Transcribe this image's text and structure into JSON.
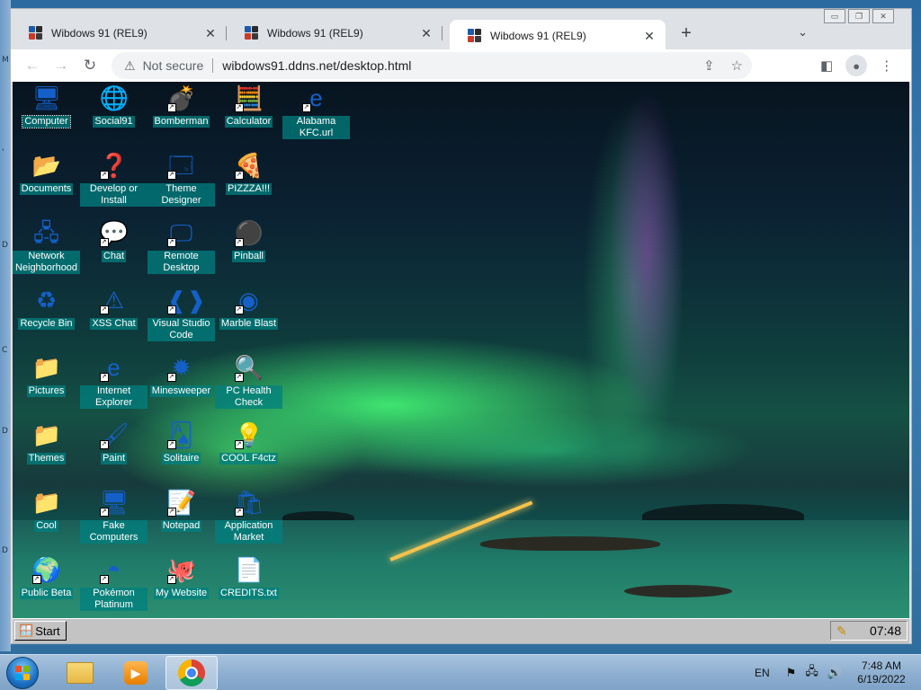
{
  "browser": {
    "tabs": [
      {
        "title": "Wibdows 91 (REL9)",
        "active": false
      },
      {
        "title": "Wibdows 91 (REL9)",
        "active": false
      },
      {
        "title": "Wibdows 91 (REL9)",
        "active": true
      }
    ],
    "new_tab": "+",
    "tab_list": "⌄",
    "security": "Not secure",
    "url": "wibdows91.ddns.net/desktop.html"
  },
  "desktop_icons": [
    {
      "label": "Computer",
      "icon": "computer-icon",
      "shortcut": false,
      "selected": true
    },
    {
      "label": "Social91",
      "icon": "globe-icon",
      "shortcut": false
    },
    {
      "label": "Bomberman",
      "icon": "bomberman-icon",
      "shortcut": true
    },
    {
      "label": "Calculator",
      "icon": "calculator-icon",
      "shortcut": true
    },
    {
      "label": "Alabama KFC.url",
      "icon": "ie-url-icon",
      "shortcut": true
    },
    {
      "label": "Documents",
      "icon": "folder-open-icon",
      "shortcut": false
    },
    {
      "label": "Develop or Install",
      "icon": "help-question-icon",
      "shortcut": true
    },
    {
      "label": "Theme Designer",
      "icon": "window-icon",
      "shortcut": true
    },
    {
      "label": "PIZZZA!!!",
      "icon": "pizza-icon",
      "shortcut": true
    },
    {
      "label": "Network Neighborhood",
      "icon": "network-icon",
      "shortcut": false
    },
    {
      "label": "Chat",
      "icon": "chat-bubble-icon",
      "shortcut": true
    },
    {
      "label": "Remote Desktop",
      "icon": "remote-desktop-icon",
      "shortcut": true
    },
    {
      "label": "Pinball",
      "icon": "pinball-icon",
      "shortcut": true
    },
    {
      "label": "Recycle Bin",
      "icon": "recycle-bin-icon",
      "shortcut": false
    },
    {
      "label": "XSS Chat",
      "icon": "warning-chat-icon",
      "shortcut": true
    },
    {
      "label": "Visual Studio Code",
      "icon": "vscode-icon",
      "shortcut": true
    },
    {
      "label": "Marble Blast",
      "icon": "marble-icon",
      "shortcut": true
    },
    {
      "label": "Pictures",
      "icon": "folder-icon",
      "shortcut": false
    },
    {
      "label": "Internet Explorer",
      "icon": "internet-explorer-icon",
      "shortcut": true
    },
    {
      "label": "Minesweeper",
      "icon": "mine-icon",
      "shortcut": true
    },
    {
      "label": "PC Health Check",
      "icon": "health-check-icon",
      "shortcut": true
    },
    {
      "label": "Themes",
      "icon": "folder-icon",
      "shortcut": false
    },
    {
      "label": "Paint",
      "icon": "paint-icon",
      "shortcut": true
    },
    {
      "label": "Solitaire",
      "icon": "cards-icon",
      "shortcut": true
    },
    {
      "label": "COOL F4ctz",
      "icon": "cool-facts-icon",
      "shortcut": true
    },
    {
      "label": "Cool",
      "icon": "folder-icon",
      "shortcut": false
    },
    {
      "label": "Fake Computers",
      "icon": "computer-icon",
      "shortcut": true
    },
    {
      "label": "Notepad",
      "icon": "notepad-icon",
      "shortcut": true
    },
    {
      "label": "Application Market",
      "icon": "market-bag-icon",
      "shortcut": true
    },
    {
      "label": "Public Beta",
      "icon": "beta-globe-icon",
      "shortcut": true
    },
    {
      "label": "Pokémon Platinum",
      "icon": "pokemon-icon",
      "shortcut": true
    },
    {
      "label": "My Website",
      "icon": "github-icon",
      "shortcut": true
    },
    {
      "label": "CREDITS.txt",
      "icon": "text-file-icon",
      "shortcut": false
    }
  ],
  "w93_taskbar": {
    "start_label": "Start",
    "clock": "07:48"
  },
  "win7_taskbar": {
    "language": "EN",
    "time": "7:48 AM",
    "date": "6/19/2022"
  },
  "colors": {
    "icon_label_bg": "#008080",
    "w93_gray": "#c3c3c3"
  }
}
